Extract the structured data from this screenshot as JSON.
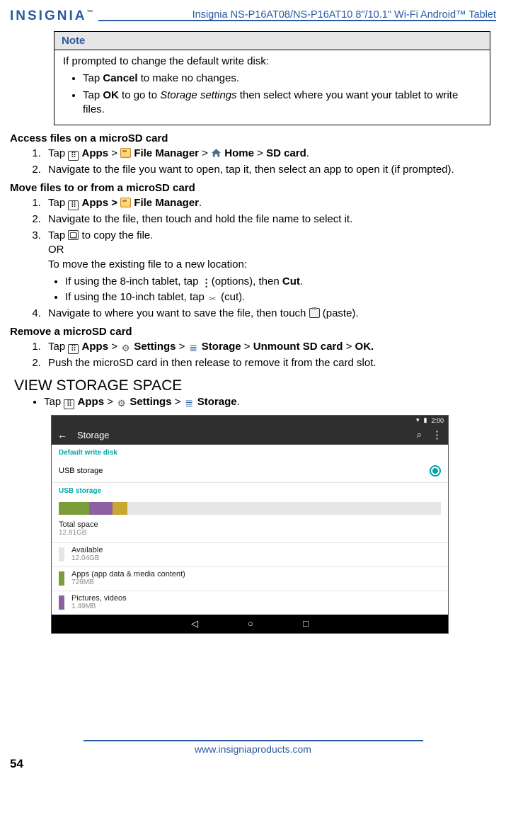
{
  "header": {
    "logo": "INSIGNIA",
    "model": "Insignia  NS-P16AT08/NS-P16AT10  8\"/10.1\" Wi-Fi Android™ Tablet"
  },
  "note": {
    "title": "Note",
    "intro": "If prompted to change the default write disk:",
    "items": [
      {
        "pre": "Tap ",
        "bold": "Cancel",
        "post": " to make no changes."
      },
      {
        "pre": "Tap ",
        "bold": "OK",
        "post_a": " to go to ",
        "ital": "Storage settings",
        "post_b": " then select where you want your tablet to write files."
      }
    ]
  },
  "access": {
    "title": "Access files on a microSD card",
    "s1": {
      "tap": "Tap ",
      "apps": "Apps",
      "gt1": " > ",
      "fm": "File Manager",
      "gt2": " > ",
      "home": "Home",
      "gt3": " > ",
      "sd": "SD card",
      "end": "."
    },
    "s2": "Navigate to the file you want to open, tap it, then select an app to open it (if prompted)."
  },
  "move": {
    "title": "Move files to or from a microSD card",
    "s1": {
      "tap": "Tap ",
      "apps": "Apps > ",
      "fm": "File Manager",
      "end": "."
    },
    "s2": "Navigate to the file, then touch and hold the file name to select it.",
    "s3": {
      "tap": "Tap ",
      "copy_after": " to copy the file.",
      "or": "OR",
      "to_move": "To move the existing file to a new location:",
      "b1_pre": "If using the 8-inch tablet, tap ",
      "b1_mid": " (options), then ",
      "b1_cut": "Cut",
      "b1_end": ".",
      "b2_pre": "If using the 10-inch tablet, tap ",
      "b2_end": " (cut)."
    },
    "s4": {
      "pre": "Navigate to where you want to save the file, then touch ",
      "post": " (paste)."
    }
  },
  "remove": {
    "title": "Remove a microSD card",
    "s1": {
      "tap": "Tap ",
      "apps": "Apps",
      "gt1": " > ",
      "settings": "Settings",
      "gt2": " > ",
      "storage": "Storage",
      "gt3": " > ",
      "unmount": "Unmount SD card",
      "gt4": " > ",
      "ok": "OK."
    },
    "s2": "Push the microSD card in then release to remove it from the card slot."
  },
  "view": {
    "heading": "VIEW STORAGE SPACE",
    "b1": {
      "tap": "Tap ",
      "apps": "Apps",
      "gt1": " > ",
      "settings": "Settings",
      "gt2": " > ",
      "storage": "Storage",
      "end": "."
    }
  },
  "shot": {
    "time": "2:00",
    "title": "Storage",
    "sec1": "Default write disk",
    "row1": "USB storage",
    "sec2": "USB storage",
    "total_k": "Total space",
    "total_v": "12.81GB",
    "avail_k": "Available",
    "avail_v": "12.04GB",
    "apps_k": "Apps (app data & media content)",
    "apps_v": "726MB",
    "pics_k": "Pictures, videos",
    "pics_v": "1.49MB"
  },
  "footer": {
    "url": "www.insigniaproducts.com",
    "page": "54"
  }
}
